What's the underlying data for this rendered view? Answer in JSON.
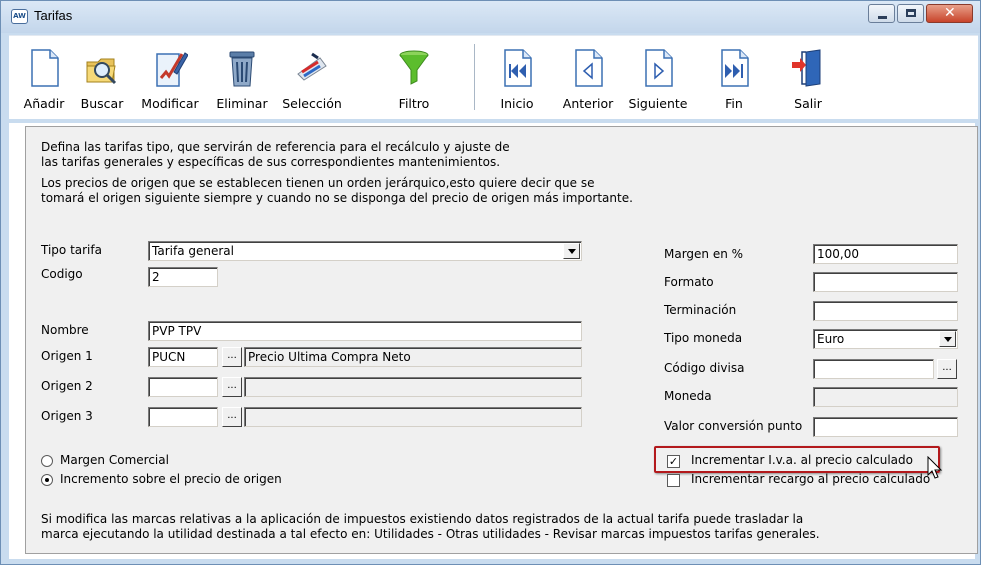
{
  "window": {
    "title": "Tarifas",
    "app_icon_text": "AW"
  },
  "toolbar": {
    "buttons": [
      {
        "label": "Añadir",
        "icon": "new-document-icon"
      },
      {
        "label": "Buscar",
        "icon": "search-folder-icon"
      },
      {
        "label": "Modificar",
        "icon": "edit-pencil-icon"
      },
      {
        "label": "Eliminar",
        "icon": "trash-can-icon"
      },
      {
        "label": "Selección",
        "icon": "selection-icon"
      },
      {
        "label": "Filtro",
        "icon": "funnel-filter-icon"
      },
      {
        "label": "Inicio",
        "icon": "first-record-icon"
      },
      {
        "label": "Anterior",
        "icon": "previous-record-icon"
      },
      {
        "label": "Siguiente",
        "icon": "next-record-icon"
      },
      {
        "label": "Fin",
        "icon": "last-record-icon"
      },
      {
        "label": "Salir",
        "icon": "exit-door-icon"
      }
    ]
  },
  "info": {
    "line1": "Defina las tarifas tipo, que servirán de referencia para el recálculo y ajuste de",
    "line2": "las tarifas generales y específicas de sus correspondientes mantenimientos.",
    "line3": "Los precios de origen que se establecen tienen un orden jerárquico,esto quiere decir que se",
    "line4": "tomará el origen siguiente siempre y cuando no se disponga del precio de origen más importante."
  },
  "form": {
    "tipo_tarifa_label": "Tipo tarifa",
    "tipo_tarifa_value": "Tarifa general",
    "codigo_label": "Codigo",
    "codigo_value": "2",
    "nombre_label": "Nombre",
    "nombre_value": "PVP TPV",
    "origen1_label": "Origen 1",
    "origen1_code": "PUCN",
    "origen1_desc": "Precio Ultima Compra Neto",
    "origen2_label": "Origen 2",
    "origen2_code": "",
    "origen3_label": "Origen 3",
    "origen3_code": "",
    "ellipsis": "...",
    "margen_label": "Margen en %",
    "margen_value": "100,00",
    "formato_label": "Formato",
    "formato_value": "",
    "terminacion_label": "Terminación",
    "terminacion_value": "",
    "tipo_moneda_label": "Tipo moneda",
    "tipo_moneda_value": "Euro",
    "codigo_divisa_label": "Código divisa",
    "codigo_divisa_value": "",
    "moneda_label": "Moneda",
    "moneda_value": "",
    "valor_conversion_label": "Valor conversión punto",
    "valor_conversion_value": ""
  },
  "options": {
    "radio_margen_comercial": "Margen Comercial",
    "radio_incremento": "Incremento sobre el precio de origen",
    "selected_radio": "incremento",
    "chk_iva_label": "Incrementar I.v.a. al precio calculado",
    "chk_iva_checked": true,
    "chk_recargo_label": "Incrementar recargo al precio calculado",
    "chk_recargo_checked": false
  },
  "footer": {
    "line1": "Si modifica las marcas relativas a la aplicación de impuestos existiendo datos registrados de la actual tarifa puede trasladar la",
    "line2": "marca ejecutando la utilidad destinada a tal efecto en: Utilidades - Otras utilidades - Revisar marcas impuestos tarifas generales."
  }
}
